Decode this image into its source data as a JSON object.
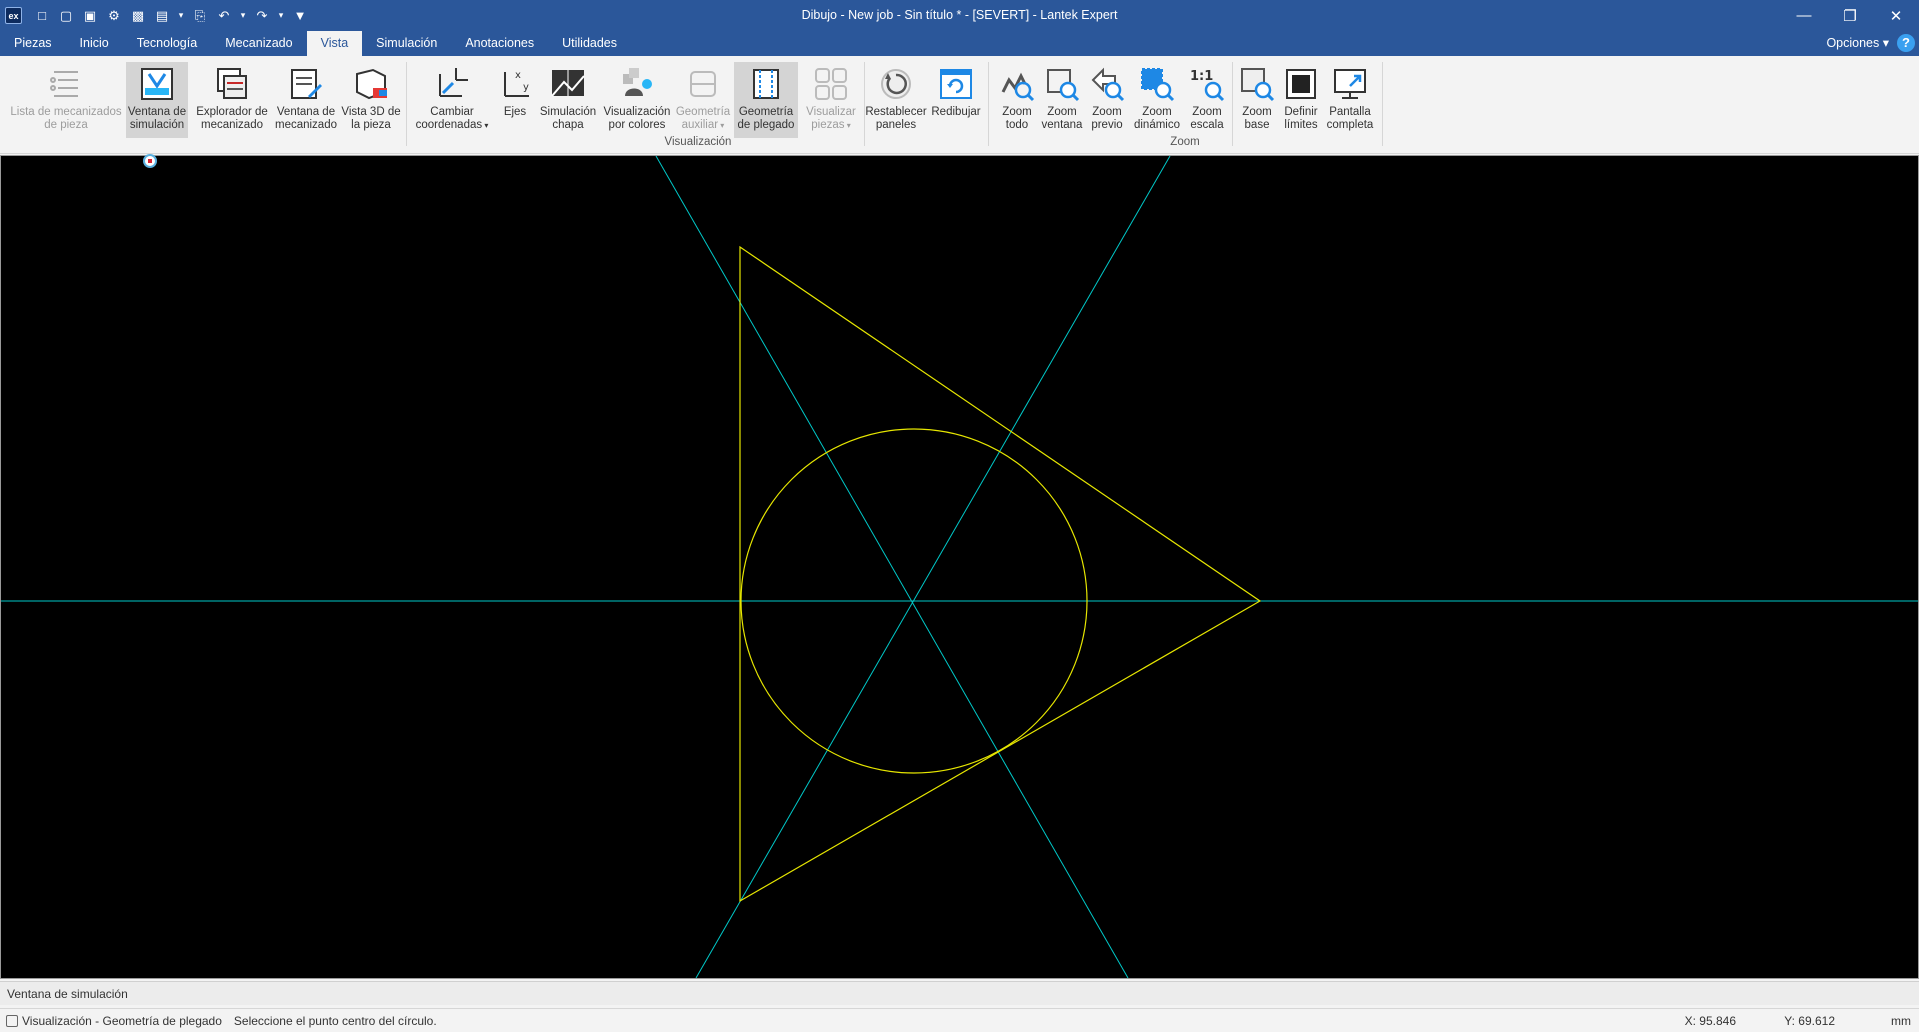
{
  "window": {
    "title": "Dibujo - New job - Sin título * - [SEVERT] - Lantek Expert",
    "logo_text": "ex"
  },
  "quick_access": [
    {
      "icon": "new-icon"
    },
    {
      "icon": "open-icon"
    },
    {
      "icon": "open-recent-icon"
    },
    {
      "icon": "settings-icon"
    },
    {
      "icon": "save-icon"
    },
    {
      "icon": "save-as-icon"
    },
    {
      "icon": "print-icon"
    },
    {
      "icon": "undo-icon"
    },
    {
      "icon": "redo-icon"
    },
    {
      "icon": "customize-toolbar-icon"
    }
  ],
  "tabs": [
    {
      "label": "Piezas",
      "active": false
    },
    {
      "label": "Inicio",
      "active": false
    },
    {
      "label": "Tecnología",
      "active": false
    },
    {
      "label": "Mecanizado",
      "active": false
    },
    {
      "label": "Vista",
      "active": true
    },
    {
      "label": "Simulación",
      "active": false
    },
    {
      "label": "Anotaciones",
      "active": false
    },
    {
      "label": "Utilidades",
      "active": false
    }
  ],
  "options_label": "Opciones",
  "help_label": "?",
  "ribbon": {
    "groups": [
      {
        "label": "Visualización"
      },
      {
        "label": "Zoom"
      }
    ],
    "buttons": [
      {
        "label": "Lista de mecanizados\nde pieza",
        "icon": "machining-list-icon",
        "disabled": true,
        "selected": false
      },
      {
        "label": "Ventana de\nsimulación",
        "icon": "simulation-window-icon",
        "disabled": false,
        "selected": true
      },
      {
        "label": "Explorador de\nmecanizado",
        "icon": "machining-explorer-icon",
        "disabled": false,
        "selected": false
      },
      {
        "label": "Ventana de\nmecanizado",
        "icon": "machining-window-icon",
        "disabled": false,
        "selected": false
      },
      {
        "label": "Vista 3D de\nla pieza",
        "icon": "part-3d-view-icon",
        "disabled": false,
        "selected": false
      },
      {
        "label": "Cambiar\ncoordenadas",
        "icon": "change-coordinates-icon",
        "disabled": false,
        "selected": false,
        "dropdown": true
      },
      {
        "label": "Ejes",
        "icon": "axes-icon",
        "disabled": false,
        "selected": false
      },
      {
        "label": "Simulación\nchapa",
        "icon": "sheet-simulation-icon",
        "disabled": false,
        "selected": false
      },
      {
        "label": "Visualización\npor colores",
        "icon": "color-view-icon",
        "disabled": false,
        "selected": false
      },
      {
        "label": "Geometría\nauxiliar",
        "icon": "auxiliary-geometry-icon",
        "disabled": true,
        "selected": false,
        "dropdown": true
      },
      {
        "label": "Geometría\nde plegado",
        "icon": "bend-geometry-icon",
        "disabled": false,
        "selected": true
      },
      {
        "label": "Visualizar\npiezas",
        "icon": "view-parts-icon",
        "disabled": true,
        "selected": false,
        "dropdown": true
      },
      {
        "label": "Restablecer\npaneles",
        "icon": "reset-panels-icon",
        "disabled": false,
        "selected": false
      },
      {
        "label": "Redibujar",
        "icon": "redraw-icon",
        "disabled": false,
        "selected": false
      },
      {
        "label": "Zoom\ntodo",
        "icon": "zoom-all-icon",
        "disabled": false,
        "selected": false
      },
      {
        "label": "Zoom\nventana",
        "icon": "zoom-window-icon",
        "disabled": false,
        "selected": false
      },
      {
        "label": "Zoom\nprevio",
        "icon": "zoom-previous-icon",
        "disabled": false,
        "selected": false
      },
      {
        "label": "Zoom\ndinámico",
        "icon": "zoom-dynamic-icon",
        "disabled": false,
        "selected": false
      },
      {
        "label": "Zoom\nescala",
        "icon": "zoom-scale-icon",
        "disabled": false,
        "selected": false,
        "icon_text": "1:1"
      },
      {
        "label": "Zoom\nbase",
        "icon": "zoom-base-icon",
        "disabled": false,
        "selected": false
      },
      {
        "label": "Definir\nlímites",
        "icon": "define-limits-icon",
        "disabled": false,
        "selected": false
      },
      {
        "label": "Pantalla\ncompleta",
        "icon": "full-screen-icon",
        "disabled": false,
        "selected": false
      }
    ]
  },
  "canvas": {
    "background": "#000000",
    "axis_color": "#00c8c8",
    "geometry_color": "#e6e600"
  },
  "panel_label": "Ventana de simulación",
  "status": {
    "mode": "Visualización - Geometría de plegado",
    "prompt": "Seleccione el punto centro del círculo.",
    "x": "X: 95.846",
    "y": "Y: 69.612",
    "units": "mm"
  }
}
